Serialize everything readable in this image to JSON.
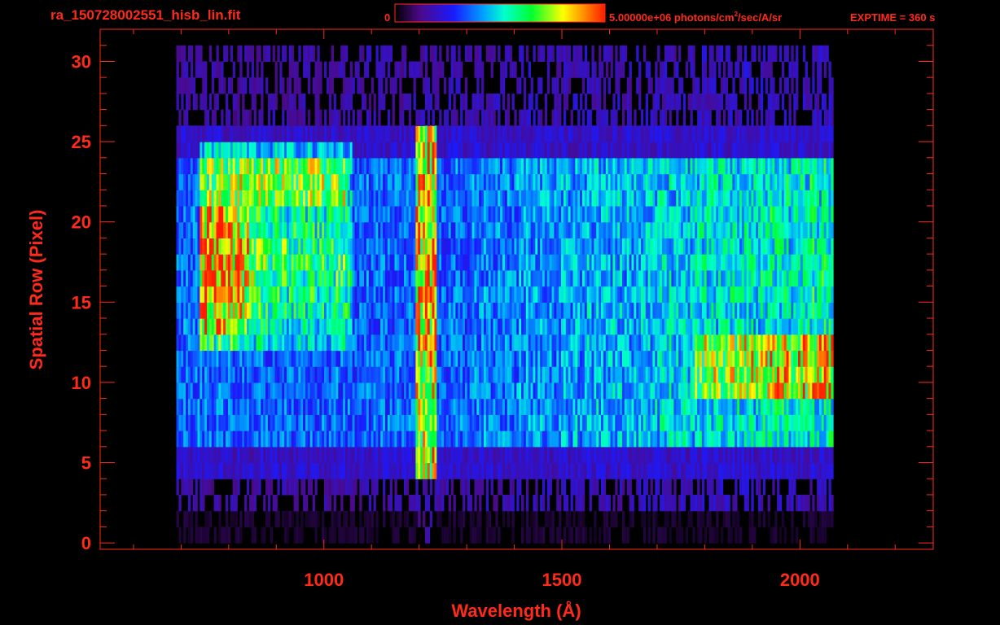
{
  "header": {
    "filename": "ra_150728002551_hisb_lin.fit",
    "colorbar_min_label": "0",
    "colorbar_max_label": "5.00000e+06 photons/cm",
    "colorbar_unit_exp": "2",
    "colorbar_unit_rest": "/sec/A/sr",
    "exptime_label": "EXPTIME = 360 s"
  },
  "colors": {
    "axis": "#ff2a1a",
    "background": "#000000"
  },
  "chart_data": {
    "type": "heatmap",
    "title": "",
    "xlabel": "Wavelength (Å)",
    "ylabel": "Spatial Row (Pixel)",
    "xlim": [
      530,
      2280
    ],
    "ylim": [
      -0.4,
      32
    ],
    "x_ticks": [
      1000,
      1500,
      2000
    ],
    "x_tick_labels": [
      "1000",
      "1500",
      "2000"
    ],
    "y_ticks": [
      0,
      5,
      10,
      15,
      20,
      25,
      30
    ],
    "y_tick_labels": [
      "0",
      "5",
      "10",
      "15",
      "20",
      "25",
      "30"
    ],
    "grid": false,
    "colorbar": {
      "min": 0,
      "max": 5000000,
      "unit": "photons/cm^2/sec/A/sr",
      "colormap": "rainbow"
    },
    "rows": {
      "first": 0,
      "last": 30
    },
    "wavelength_coverage": [
      690,
      2070
    ],
    "features": [
      {
        "name": "Lyman-alpha line",
        "wavelength": 1216,
        "rows": [
          4,
          25
        ],
        "peak": 0.92
      },
      {
        "name": "bright extended continuum",
        "wavelength_range": [
          760,
          1050
        ],
        "rows": [
          12,
          24
        ],
        "peak": 0.95
      },
      {
        "name": "red-end continuum",
        "wavelength_range": [
          1780,
          2060
        ],
        "rows": [
          9,
          12
        ],
        "peak": 0.9
      }
    ]
  }
}
